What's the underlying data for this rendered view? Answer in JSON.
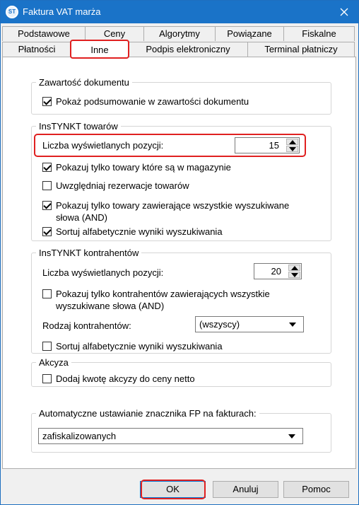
{
  "window": {
    "title": "Faktura VAT marża",
    "app_icon_text": "ST"
  },
  "tabs": {
    "row1": [
      "Podstawowe",
      "Ceny",
      "Algorytmy",
      "Powiązane",
      "Fiskalne"
    ],
    "row2": [
      "Płatności",
      "Inne",
      "Podpis elektroniczny",
      "Terminal płatniczy"
    ],
    "active": "Inne"
  },
  "zawartosc": {
    "legend": "Zawartość dokumentu",
    "show_summary": {
      "label": "Pokaż podsumowanie w zawartości dokumentu",
      "checked": true
    }
  },
  "instynkt_towarow": {
    "legend": "InsTYNKT towarów",
    "count_label": "Liczba wyświetlanych pozycji:",
    "count_value": "15",
    "only_in_stock": {
      "label": "Pokazuj tylko towary które są w magazynie",
      "checked": true
    },
    "reservations": {
      "label": "Uwzględniaj rezerwacje towarów",
      "checked": false
    },
    "all_words": {
      "label": "Pokazuj tylko towary zawierające wszystkie wyszukiwane słowa (AND)",
      "checked": true
    },
    "sort_alpha": {
      "label": "Sortuj alfabetycznie wyniki wyszukiwania",
      "checked": true
    }
  },
  "instynkt_kontrahentow": {
    "legend": "InsTYNKT kontrahentów",
    "count_label": "Liczba wyświetlanych pozycji:",
    "count_value": "20",
    "all_words": {
      "label": "Pokazuj tylko kontrahentów zawierających wszystkie wyszukiwane słowa (AND)",
      "checked": false
    },
    "kind_label": "Rodzaj kontrahentów:",
    "kind_value": "(wszyscy)",
    "sort_alpha": {
      "label": "Sortuj alfabetycznie wyniki wyszukiwania",
      "checked": false
    }
  },
  "akcyza": {
    "legend": "Akcyza",
    "add_excise": {
      "label": "Dodaj kwotę akcyzy do ceny netto",
      "checked": false
    }
  },
  "fp_marker": {
    "legend": "Automatyczne ustawianie znacznika FP na fakturach:",
    "value": "zafiskalizowanych"
  },
  "buttons": {
    "ok": "OK",
    "cancel": "Anuluj",
    "help": "Pomoc"
  },
  "colors": {
    "titlebar": "#1a73c8",
    "highlight": "#e02020"
  }
}
